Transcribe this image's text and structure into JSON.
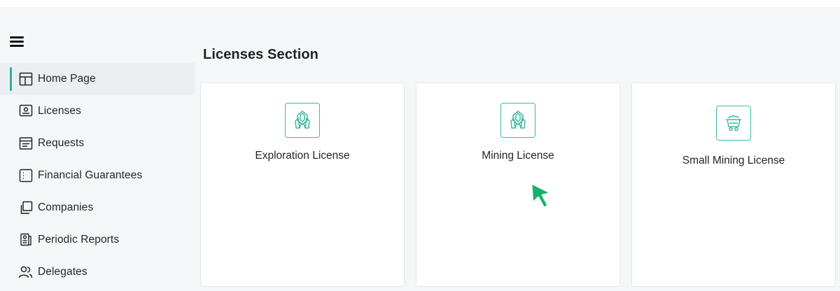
{
  "menu": {
    "icon": "hamburger-menu-icon"
  },
  "sidebar": {
    "items": [
      {
        "label": "Home Page",
        "icon": "layout-icon",
        "active": true
      },
      {
        "label": "Licenses",
        "icon": "id-card-icon"
      },
      {
        "label": "Requests",
        "icon": "document-list-icon"
      },
      {
        "label": "Financial Guarantees",
        "icon": "ledger-icon"
      },
      {
        "label": "Companies",
        "icon": "copy-squares-icon"
      },
      {
        "label": "Periodic Reports",
        "icon": "report-icon"
      },
      {
        "label": "Delegates",
        "icon": "users-icon"
      }
    ]
  },
  "main": {
    "section_title": "Licenses Section",
    "cards": [
      {
        "label": "Exploration License",
        "icon": "crystal-icon"
      },
      {
        "label": "Mining License",
        "icon": "crystal-icon"
      },
      {
        "label": "Small Mining License",
        "icon": "mine-cart-icon"
      }
    ]
  },
  "colors": {
    "accent": "#3fb8a0",
    "active_indicator": "#2bb39a",
    "cursor": "#17b169"
  }
}
